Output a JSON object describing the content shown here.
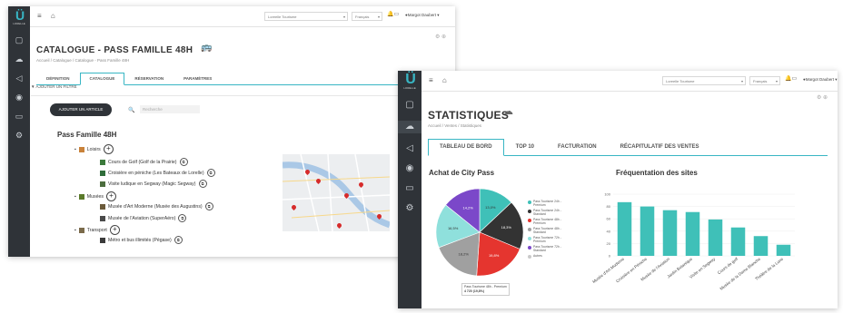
{
  "w1": {
    "logo": {
      "mark": "Ü",
      "text": "LORELLE"
    },
    "topbar": {
      "menu_icon": "≡",
      "home_icon": "⌂",
      "select1": "Loreelle Tourisme",
      "select2": "Français",
      "user": "Margot Daubert"
    },
    "title": "CATALOGUE - PASS FAMILLE 48H",
    "breadcrumb": "Accueil / Catalogue / Catalogue - Pass Famille 48H",
    "tabs": [
      "DÉFINITION",
      "CATALOGUE",
      "RÉSERVATION",
      "PARAMÈTRES"
    ],
    "filter": "▼ AJOUTER UN FILTRE",
    "add_button": "AJOUTER UN ARTICLE",
    "search_placeholder": "Recherche",
    "tree": {
      "title": "Pass Famille 48H",
      "cat1": "Loisirs",
      "item1": "Cours de Golf (Golf de la Prairie)",
      "item2": "Croisière en péniche (Les Bateaux de Lorelle)",
      "item3": "Visite ludique en Segway (Magic Segway)",
      "cat2": "Musées",
      "item4": "Musée d'Art Moderne (Musée des Augustins)",
      "item5": "Musée de l'Aviation (SuperAéro)",
      "cat3": "Transport",
      "item6": "Métro et bus illimités (Pégase)"
    }
  },
  "w2": {
    "logo": {
      "mark": "Ü",
      "text": "LORELLE"
    },
    "topbar": {
      "menu_icon": "≡",
      "home_icon": "⌂",
      "select1": "Loreelle Tourisme",
      "select2": "Français",
      "user": "Margot Daubert"
    },
    "title": "STATISTIQUES",
    "breadcrumb": "Accueil / Ventes / Statistiques",
    "tabs": [
      "TABLEAU DE BORD",
      "TOP 10",
      "FACTURATION",
      "RÉCAPITULATIF DES VENTES"
    ],
    "pie_title": "Achat de City Pass",
    "bar_title": "Fréquentation des sites",
    "tooltip_line1": "Pass Tourisme 48h - Premium",
    "tooltip_line2": "4 720 (19,8%)"
  },
  "colors": {
    "accent": "#38b6c4",
    "sidebar": "#2f3338"
  },
  "chart_data": [
    {
      "type": "pie",
      "title": "Achat de City Pass",
      "categories": [
        "Pass Tourisme 24h - Premium",
        "Pass Tourisme 24h - Standard",
        "Pass Tourisme 48h - Premium",
        "Pass Tourisme 48h - Standard",
        "Pass Tourisme 72h - Premium",
        "Pass Tourisme 72h - Standard",
        "Autres"
      ],
      "values": [
        13.0,
        18.3,
        19.8,
        18.2,
        16.5,
        14.2,
        0
      ],
      "labels": [
        "13,0%",
        "18,3%",
        "19,8%",
        "18,2%",
        "16,5%",
        "14,2%",
        ""
      ],
      "colors": [
        "#3fc0b8",
        "#333333",
        "#e5352f",
        "#a0a0a0",
        "#8fe0dc",
        "#7b48c9",
        "#c9c9c9"
      ]
    },
    {
      "type": "bar",
      "title": "Fréquentation des sites",
      "categories": [
        "Musée d'Art Moderne",
        "Croisière en Péniche",
        "Musée de l'Aviation",
        "Jardin Botanique",
        "Visite en Segway",
        "Cours de golf",
        "Musée de la Dame Blanche",
        "Théâtre de la Lune"
      ],
      "values": [
        87,
        80,
        74,
        71,
        59,
        46,
        32,
        18
      ],
      "ylim": [
        0,
        100
      ],
      "yticks": [
        0,
        20,
        40,
        60,
        80,
        100
      ],
      "color": "#3fc0b8"
    }
  ]
}
